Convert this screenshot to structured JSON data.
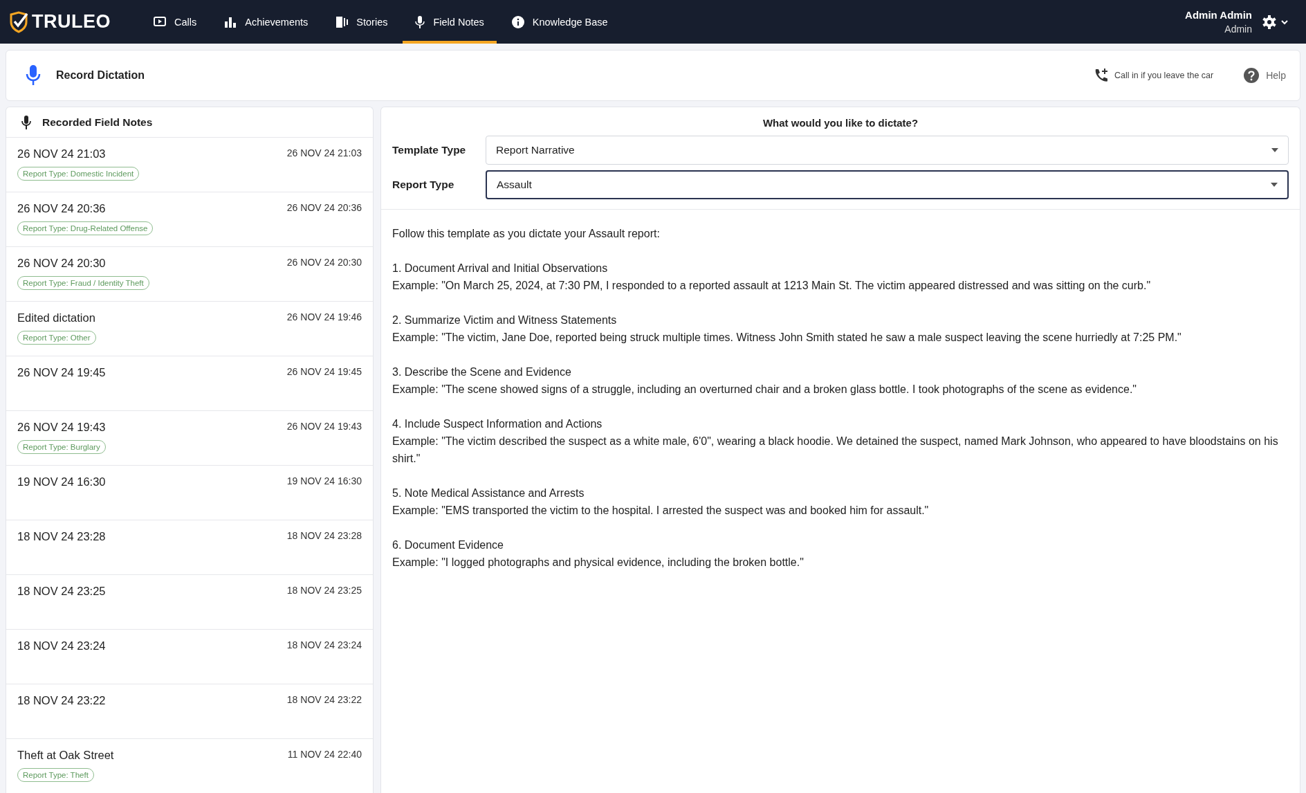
{
  "brand": {
    "name": "TRULEO"
  },
  "nav": [
    {
      "label": "Calls",
      "kind": "play",
      "selected": false
    },
    {
      "label": "Achievements",
      "kind": "bars",
      "selected": false
    },
    {
      "label": "Stories",
      "kind": "stories",
      "selected": false
    },
    {
      "label": "Field Notes",
      "kind": "mic",
      "selected": true
    },
    {
      "label": "Knowledge Base",
      "kind": "info",
      "selected": false
    }
  ],
  "user": {
    "name": "Admin Admin",
    "role": "Admin"
  },
  "record_bar": {
    "title": "Record Dictation",
    "call_in": "Call in if you leave the car",
    "help": "Help"
  },
  "notes_panel": {
    "title": "Recorded Field Notes",
    "items": [
      {
        "title": "26 NOV 24 21:03",
        "date": "26 NOV 24 21:03",
        "tag": "Report Type: Domestic Incident"
      },
      {
        "title": "26 NOV 24 20:36",
        "date": "26 NOV 24 20:36",
        "tag": "Report Type: Drug-Related Offense"
      },
      {
        "title": "26 NOV 24 20:30",
        "date": "26 NOV 24 20:30",
        "tag": "Report Type: Fraud / Identity Theft"
      },
      {
        "title": "Edited dictation",
        "date": "26 NOV 24 19:46",
        "tag": "Report Type: Other"
      },
      {
        "title": "26 NOV 24 19:45",
        "date": "26 NOV 24 19:45"
      },
      {
        "title": "26 NOV 24 19:43",
        "date": "26 NOV 24 19:43",
        "tag": "Report Type: Burglary"
      },
      {
        "title": "19 NOV 24 16:30",
        "date": "19 NOV 24 16:30"
      },
      {
        "title": "18 NOV 24 23:28",
        "date": "18 NOV 24 23:28"
      },
      {
        "title": "18 NOV 24 23:25",
        "date": "18 NOV 24 23:25"
      },
      {
        "title": "18 NOV 24 23:24",
        "date": "18 NOV 24 23:24"
      },
      {
        "title": "18 NOV 24 23:22",
        "date": "18 NOV 24 23:22"
      },
      {
        "title": "Theft at Oak Street",
        "date": "11 NOV 24 22:40",
        "tag": "Report Type: Theft"
      }
    ]
  },
  "dictate": {
    "question": "What would you like to dictate?",
    "fields": [
      {
        "label": "Template Type",
        "value": "Report Narrative",
        "focused": false
      },
      {
        "label": "Report Type",
        "value": "Assault",
        "focused": true
      }
    ],
    "intro": "Follow this template as you dictate your Assault report:",
    "steps": [
      {
        "title": "1. Document Arrival and Initial Observations",
        "example": "Example: \"On March 25, 2024, at 7:30 PM, I responded to a reported assault at 1213 Main St. The victim appeared distressed and was sitting on the curb.\""
      },
      {
        "title": "2. Summarize Victim and Witness Statements",
        "example": "Example: \"The victim, Jane Doe, reported being struck multiple times. Witness John Smith stated he saw a male suspect leaving the scene hurriedly at 7:25 PM.\""
      },
      {
        "title": "3. Describe the Scene and Evidence",
        "example": "Example: \"The scene showed signs of a struggle, including an overturned chair and a broken glass bottle. I took photographs of the scene as evidence.\""
      },
      {
        "title": "4. Include Suspect Information and Actions",
        "example": "Example: \"The victim described the suspect as a white male, 6'0\", wearing a black hoodie. We detained the suspect, named Mark Johnson, who appeared to have bloodstains on his shirt.\""
      },
      {
        "title": "5. Note Medical Assistance and Arrests",
        "example": "Example: \"EMS transported the victim to the hospital. I arrested the suspect was and booked him for assault.\""
      },
      {
        "title": "6. Document Evidence",
        "example": "Example: \"I logged photographs and physical evidence, including the broken bottle.\""
      }
    ]
  }
}
